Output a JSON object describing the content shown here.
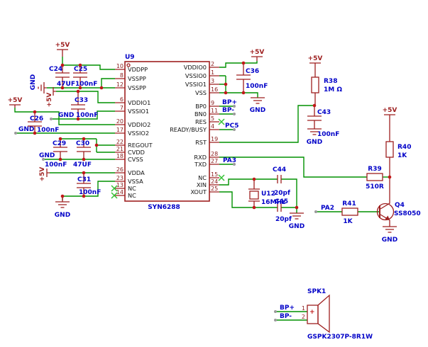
{
  "type": "circuit-schematic",
  "colors": {
    "wire": "#009100",
    "symbol": "#9E1F1F",
    "label": "#0202C8",
    "junction": "#C01818",
    "no_connect": "#35C135"
  },
  "power": {
    "v5": "+5V",
    "gnd": "GND"
  },
  "net_labels": {
    "bp_plus": "BP+",
    "bp_minus": "BP-",
    "pc5": "PC5",
    "pa3": "PA3",
    "pa2": "PA2"
  },
  "ic": {
    "ref": "U9",
    "part": "SYN6288",
    "left_pins": [
      {
        "num": "10",
        "name": "VDDPP"
      },
      {
        "num": "8",
        "name": "VSSPP"
      },
      {
        "num": "12",
        "name": "VSSPP"
      },
      {
        "num": "6",
        "name": "VDDIO1"
      },
      {
        "num": "7",
        "name": "VSSIO1"
      },
      {
        "num": "20",
        "name": "VDDIO2"
      },
      {
        "num": "17",
        "name": "VSSIO2"
      },
      {
        "num": "22",
        "name": "REGOUT"
      },
      {
        "num": "21",
        "name": "CVDD"
      },
      {
        "num": "18",
        "name": "CVSS"
      },
      {
        "num": "26",
        "name": "VDDA"
      },
      {
        "num": "23",
        "name": "VSSA"
      },
      {
        "num": "13",
        "name": "NC"
      },
      {
        "num": "14",
        "name": "NC"
      }
    ],
    "right_pins": [
      {
        "num": "2",
        "name": "VDDIO0"
      },
      {
        "num": "1",
        "name": "VSSIO0"
      },
      {
        "num": "3",
        "name": "VSSIO1"
      },
      {
        "num": "16",
        "name": "VSS"
      },
      {
        "num": "9",
        "name": "BP0"
      },
      {
        "num": "11",
        "name": "BN0"
      },
      {
        "num": "5",
        "name": "RES"
      },
      {
        "num": "4",
        "name": "READY/BUSY"
      },
      {
        "num": "19",
        "name": "RST"
      },
      {
        "num": "28",
        "name": "RXD"
      },
      {
        "num": "27",
        "name": "TXD"
      },
      {
        "num": "15",
        "name": "NC"
      },
      {
        "num": "24",
        "name": "XIN"
      },
      {
        "num": "25",
        "name": "XOUT"
      }
    ]
  },
  "components": {
    "C24": {
      "ref": "C24",
      "value": "47UF"
    },
    "C25": {
      "ref": "C25",
      "value": "100nF"
    },
    "C26": {
      "ref": "C26",
      "value": "100nF"
    },
    "C29": {
      "ref": "C29",
      "value": "100nF"
    },
    "C30": {
      "ref": "C30",
      "value": "47UF"
    },
    "C31": {
      "ref": "C31",
      "value": "100nF"
    },
    "C33": {
      "ref": "C33",
      "value": "100nF"
    },
    "C36": {
      "ref": "C36",
      "value": "100nF"
    },
    "C43": {
      "ref": "C43",
      "value": "100nF"
    },
    "C44": {
      "ref": "C44",
      "value": "20pf"
    },
    "C45": {
      "ref": "C45",
      "value": "20pf"
    },
    "R38": {
      "ref": "R38",
      "value": "1M Ω"
    },
    "R39": {
      "ref": "R39",
      "value": "510R"
    },
    "R40": {
      "ref": "R40",
      "value": "1K"
    },
    "R41": {
      "ref": "R41",
      "value": "1K"
    },
    "Q4": {
      "ref": "Q4",
      "value": "SS8050"
    },
    "U12": {
      "ref": "U12",
      "value": "16MHz"
    },
    "SPK1": {
      "ref": "SPK1",
      "part": "GSPK2307P-8R1W",
      "pin1": "1",
      "pin2": "2",
      "polarity": "+"
    }
  }
}
